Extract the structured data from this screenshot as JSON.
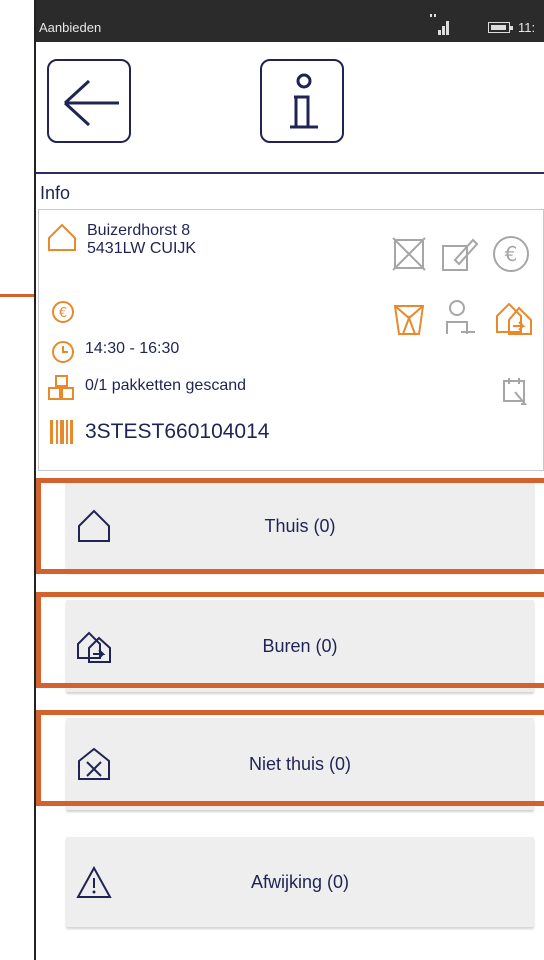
{
  "statusbar": {
    "app_name": "Aanbieden",
    "time": "11:"
  },
  "toolbar": {
    "back_icon": "arrow-left-icon",
    "info_icon": "info-icon"
  },
  "section": {
    "title": "Info"
  },
  "address": {
    "street": "Buizerdhorst 8",
    "postal_city": "5431LW CUIJK"
  },
  "delivery": {
    "time_window": "14:30 - 16:30",
    "packages_scanned": "0/1 pakketten gescand",
    "barcode": "3STEST660104014"
  },
  "status_icons": {
    "gray_row": [
      "no-signature-icon",
      "signature-icon",
      "euro-icon"
    ],
    "orange_row": [
      "package-open-icon",
      "person-id-icon",
      "neighbour-icon"
    ],
    "extra": "scan-calendar-icon"
  },
  "actions": [
    {
      "label": "Thuis (0)",
      "icon": "home-icon"
    },
    {
      "label": "Buren (0)",
      "icon": "neighbour-icon"
    },
    {
      "label": "Niet thuis (0)",
      "icon": "not-home-icon"
    },
    {
      "label": "Afwijking (0)",
      "icon": "warning-icon"
    }
  ],
  "colors": {
    "navy": "#1f2454",
    "orange": "#e8892c",
    "highlight": "#d2622e",
    "gray_icon": "#a6a6a6"
  }
}
